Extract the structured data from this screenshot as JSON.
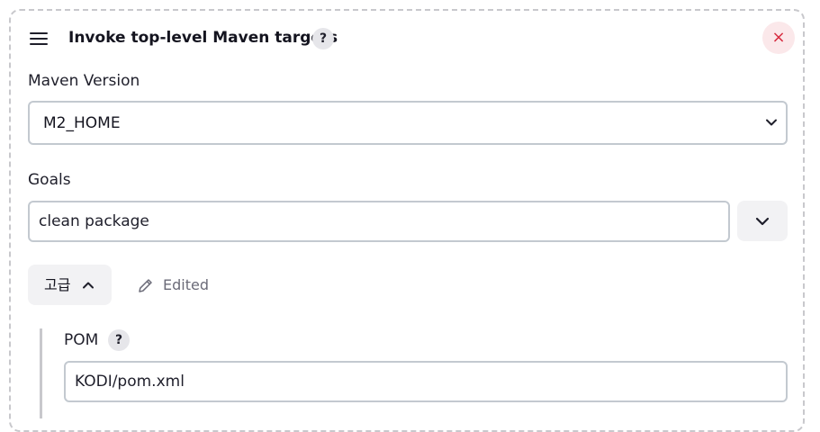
{
  "step": {
    "title": "Invoke top-level Maven targets",
    "help_glyph": "?",
    "close_glyph": "×",
    "drag_icon": "hamburger-menu-icon",
    "delete_color": "#d72b3f"
  },
  "maven_version": {
    "label": "Maven Version",
    "selected": "M2_HOME"
  },
  "goals": {
    "label": "Goals",
    "value": "clean package"
  },
  "advanced": {
    "button_label": "고급",
    "state_icon": "chevron-up-icon",
    "edited_label": "Edited"
  },
  "pom": {
    "label": "POM",
    "help_glyph": "?",
    "value": "KODI/pom.xml"
  }
}
